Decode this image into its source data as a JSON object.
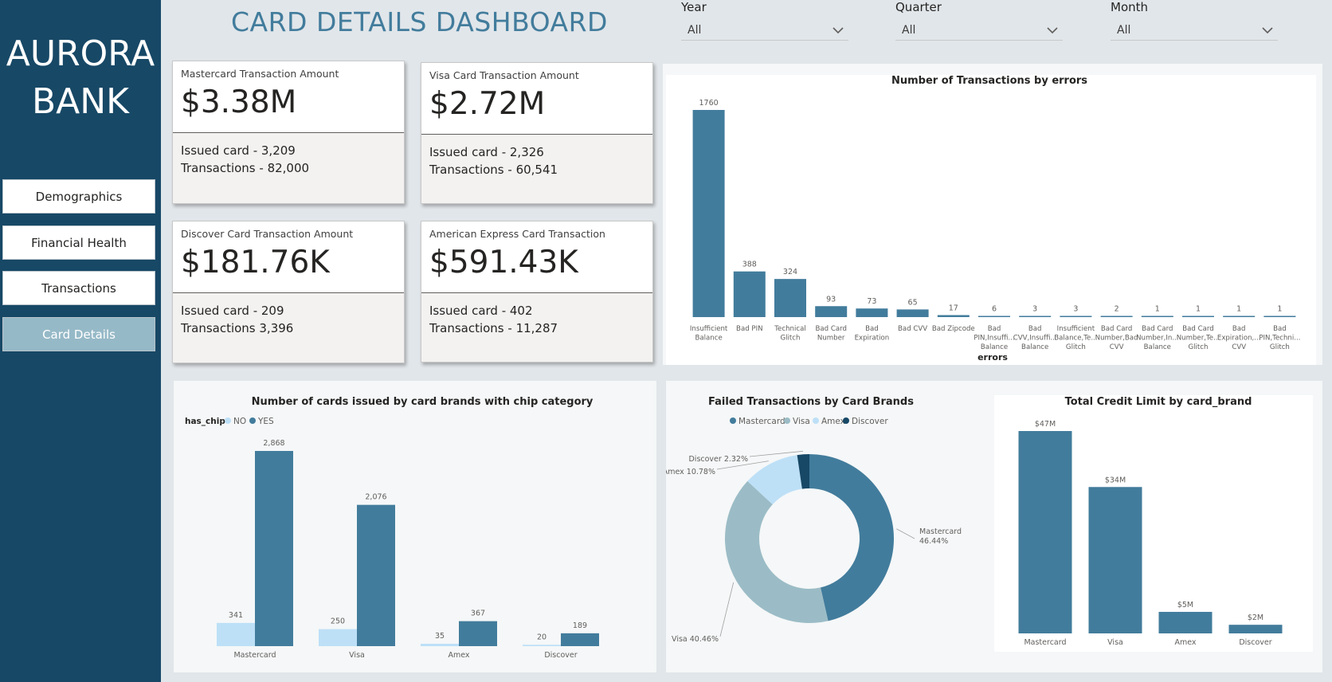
{
  "sidebar": {
    "brand_line1": "AURORA",
    "brand_line2": "BANK",
    "nav": [
      "Demographics",
      "Financial Health",
      "Transactions",
      "Card Details"
    ],
    "active_index": 3
  },
  "header": {
    "title": "CARD DETAILS DASHBOARD"
  },
  "filters": [
    {
      "label": "Year",
      "value": "All"
    },
    {
      "label": "Quarter",
      "value": "All"
    },
    {
      "label": "Month",
      "value": "All"
    }
  ],
  "kpis": [
    {
      "label": "Mastercard Transaction Amount",
      "value": "$3.38M",
      "line1": "Issued card - 3,209",
      "line2": "Transactions -  82,000"
    },
    {
      "label": "Visa Card Transaction Amount",
      "value": "$2.72M",
      "line1": "Issued card -  2,326",
      "line2": "Transactions -  60,541"
    },
    {
      "label": "Discover Card Transaction Amount",
      "value": "$181.76K",
      "line1": "Issued card -  209",
      "line2": "Transactions 3,396"
    },
    {
      "label": "American Express Card Transaction",
      "value": "$591.43K",
      "line1": "Issued card -  402",
      "line2": "Transactions -  11,287"
    }
  ],
  "colors": {
    "primary": "#427c9c",
    "light_blue": "#bde0f7",
    "grey_blue": "#9bbcc6",
    "dark": "#174866",
    "sidebar": "#174866",
    "active_nav": "#96b9c7"
  },
  "chart_data": [
    {
      "id": "errors",
      "type": "bar",
      "title": "Number of Transactions by errors",
      "xlabel": "errors",
      "ylabel": "",
      "categories": [
        [
          "Insufficient",
          "Balance"
        ],
        [
          "Bad PIN"
        ],
        [
          "Technical",
          "Glitch"
        ],
        [
          "Bad Card",
          "Number"
        ],
        [
          "Bad",
          "Expiration"
        ],
        [
          "Bad CVV"
        ],
        [
          "Bad Zipcode"
        ],
        [
          "Bad",
          "PIN,Insuffi...",
          "Balance"
        ],
        [
          "Bad",
          "CVV,Insuffi...",
          "Balance"
        ],
        [
          "Insufficient",
          "Balance,Te...",
          "Glitch"
        ],
        [
          "Bad Card",
          "Number,Bad",
          "CVV"
        ],
        [
          "Bad Card",
          "Number,In...",
          "Balance"
        ],
        [
          "Bad Card",
          "Number,Te...",
          "Glitch"
        ],
        [
          "Bad",
          "Expiration,...",
          "CVV"
        ],
        [
          "Bad",
          "PIN,Techni...",
          "Glitch"
        ]
      ],
      "values": [
        1760,
        388,
        324,
        93,
        73,
        65,
        17,
        6,
        3,
        3,
        2,
        1,
        1,
        1,
        1
      ],
      "data_labels": [
        "1760",
        "388",
        "324",
        "93",
        "73",
        "65",
        "17",
        "6",
        "3",
        "3",
        "2",
        "1",
        "1",
        "1",
        "1"
      ],
      "ylim": [
        0,
        1760
      ]
    },
    {
      "id": "chip",
      "type": "bar",
      "title": "Number of cards issued by card brands with chip category",
      "legend_title": "has_chip",
      "categories": [
        "Mastercard",
        "Visa",
        "Amex",
        "Discover"
      ],
      "series": [
        {
          "name": "NO",
          "values": [
            341,
            250,
            35,
            20
          ],
          "labels": [
            "341",
            "250",
            "35",
            "20"
          ],
          "color": "#bde0f7"
        },
        {
          "name": "YES",
          "values": [
            2868,
            2076,
            367,
            189
          ],
          "labels": [
            "2,868",
            "2,076",
            "367",
            "189"
          ],
          "color": "#427c9c"
        }
      ],
      "ylim": [
        0,
        2868
      ]
    },
    {
      "id": "failed",
      "type": "pie",
      "title": "Failed Transactions by Card Brands",
      "legend": [
        "Mastercard",
        "Visa",
        "Amex",
        "Discover"
      ],
      "slices": [
        {
          "name": "Mastercard",
          "value": 46.44,
          "label_name": "Mastercard",
          "label_pct": "46.44%",
          "color": "#427c9c"
        },
        {
          "name": "Visa",
          "value": 40.46,
          "label_name": "Visa",
          "label_pct": "40.46%",
          "color": "#9bbcc6"
        },
        {
          "name": "Amex",
          "value": 10.78,
          "label_name": "Amex",
          "label_pct": "10.78%",
          "color": "#bde0f7"
        },
        {
          "name": "Discover",
          "value": 2.32,
          "label_name": "Discover",
          "label_pct": "2.32%",
          "color": "#174866"
        }
      ]
    },
    {
      "id": "credit",
      "type": "bar",
      "title": "Total Credit Limit by card_brand",
      "categories": [
        "Mastercard",
        "Visa",
        "Amex",
        "Discover"
      ],
      "values": [
        47,
        34,
        5,
        2
      ],
      "data_labels": [
        "$47M",
        "$34M",
        "$5M",
        "$2M"
      ],
      "ylim": [
        0,
        47
      ]
    }
  ]
}
